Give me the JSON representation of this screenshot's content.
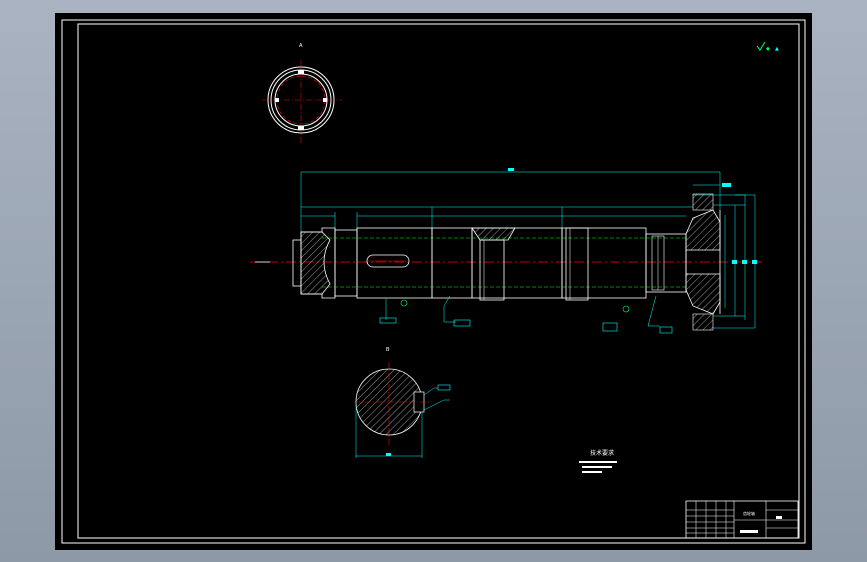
{
  "colors": {
    "viewport_bg": "#8e99a8",
    "paper": "#000000",
    "frame": "#ffffff",
    "outline": "#ffffff",
    "dimension": "#00ffff",
    "centerline": "#ff0000",
    "hidden": "#00ff00",
    "hatch": "#ffffff",
    "leader": "#00ffff",
    "accent_green": "#00ff66"
  },
  "icons": {
    "corner_mark": "roughness-symbol-icon"
  },
  "drawing": {
    "section_label_top": "A",
    "section_label_bottom": "B",
    "tech_req_title": "技术要求",
    "title_block_text": "齿轮轴"
  }
}
